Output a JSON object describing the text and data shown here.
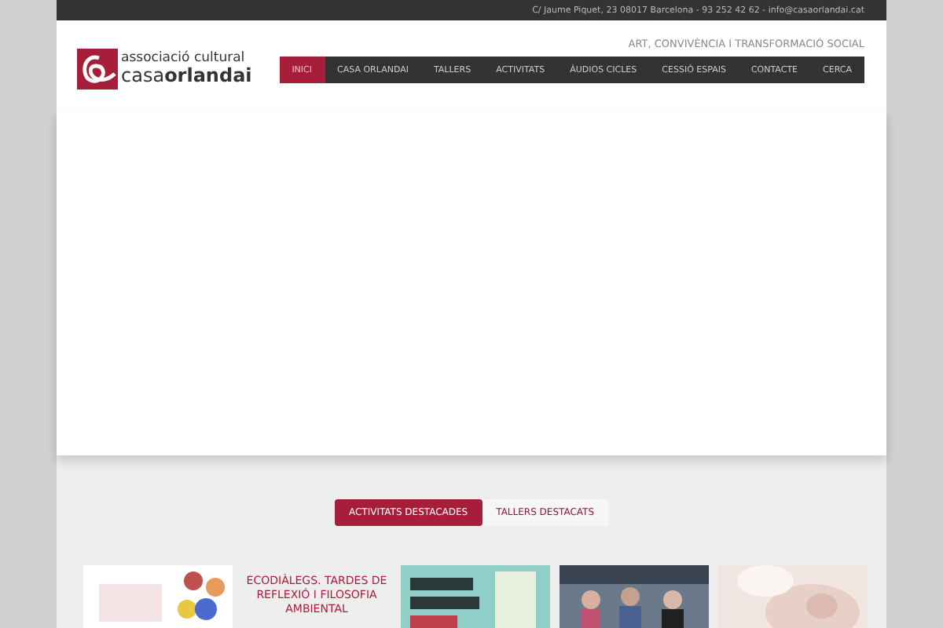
{
  "top_bar": {
    "contact": "C/ Jaume Piquet, 23 08017 Barcelona - 93 252 42 62 - info@casaorlandai.cat"
  },
  "logo": {
    "line_1": "associació cultural",
    "line_2": "casa**orlandai**"
  },
  "tagline": "ART, CONVIVÈNCIA I TRANSFORMACIÓ SOCIAL",
  "nav": [
    {
      "label": "INICI",
      "selected": true
    },
    {
      "label": "CASA ORLANDAI",
      "selected": false
    },
    {
      "label": "TALLERS",
      "selected": false
    },
    {
      "label": "ACTIVITATS",
      "selected": false
    },
    {
      "label": "ÀUDIOS CICLES",
      "selected": false
    },
    {
      "label": "CESSIÓ ESPAIS",
      "selected": false
    },
    {
      "label": "CONTACTE",
      "selected": false
    },
    {
      "label": "CERCA",
      "selected": false
    }
  ],
  "section_tabs": [
    {
      "label": "ACTIVITATS DESTACADES",
      "selected": true
    },
    {
      "label": "TALLERS DESTACATS",
      "selected": false
    }
  ],
  "cards": [
    {
      "kind": "picture"
    },
    {
      "kind": "text",
      "title": "ECODIÀLEGS. TARDES DE REFLEXIÓ I FILOSOFIA AMBIENTAL"
    },
    {
      "kind": "picture"
    },
    {
      "kind": "picture"
    },
    {
      "kind": "picture"
    }
  ]
}
